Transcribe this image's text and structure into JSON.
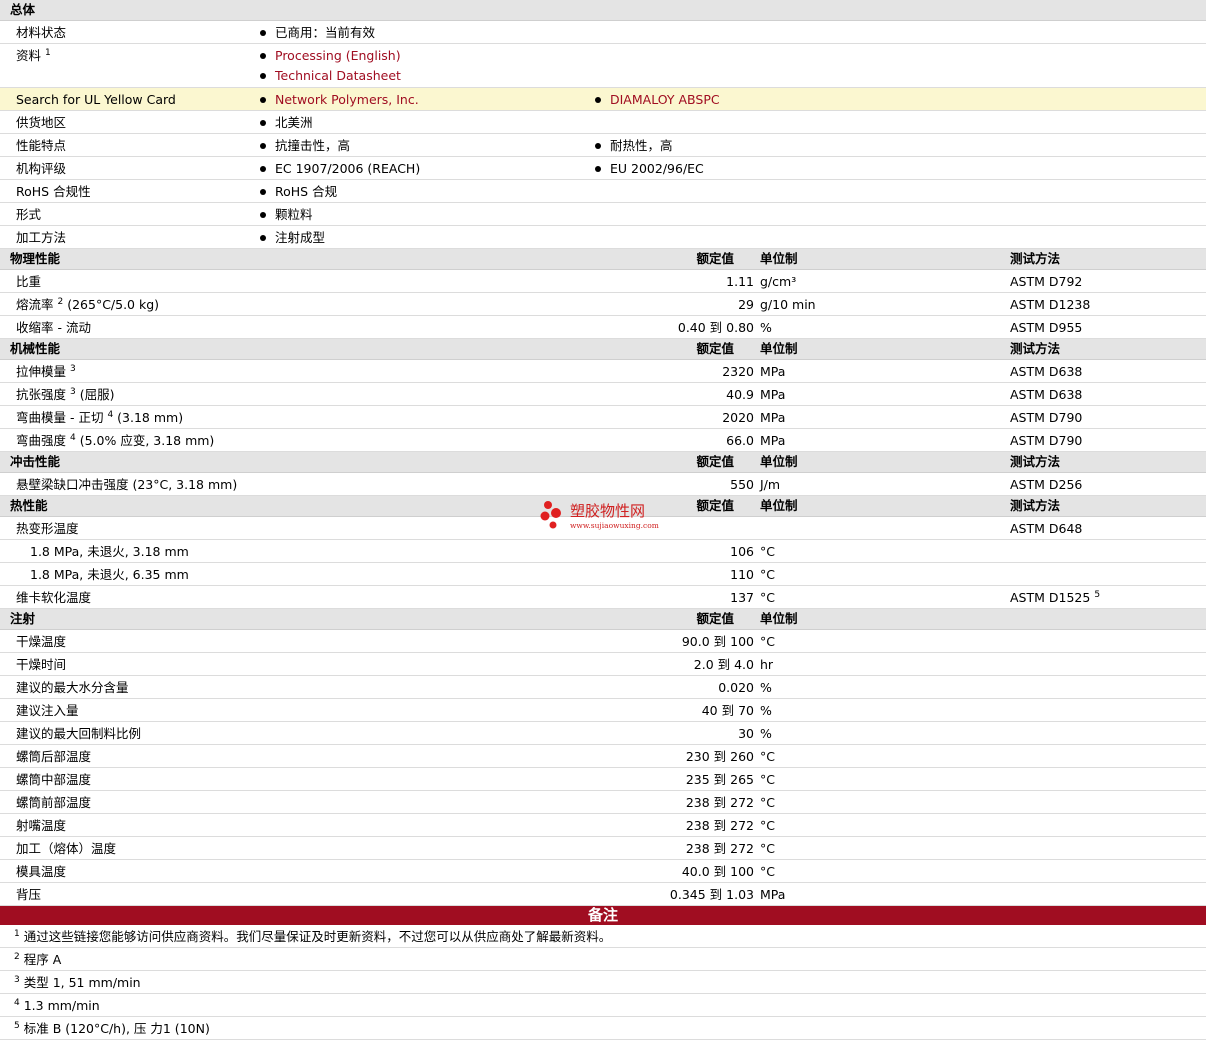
{
  "general": {
    "title": "总体",
    "rows": [
      {
        "label": "材料状态",
        "items": [
          {
            "text": "已商用：当前有效"
          }
        ]
      },
      {
        "label": "资料",
        "sup": "1",
        "items": [
          {
            "text": "Processing (English)",
            "link": true
          },
          {
            "text": "Technical Datasheet",
            "link": true
          }
        ]
      },
      {
        "label": "Search for UL Yellow Card",
        "items": [
          {
            "text": "Network Polymers, Inc.",
            "link": true
          },
          {
            "text": "DIAMALOY ABSPC",
            "link": true
          }
        ]
      },
      {
        "label": "供货地区",
        "items": [
          {
            "text": "北美洲"
          }
        ]
      },
      {
        "label": "性能特点",
        "items": [
          {
            "text": "抗撞击性，高"
          },
          {
            "text": "耐热性，高"
          }
        ]
      },
      {
        "label": "机构评级",
        "items": [
          {
            "text": "EC 1907/2006 (REACH)"
          },
          {
            "text": "EU 2002/96/EC"
          }
        ]
      },
      {
        "label": "RoHS 合规性",
        "items": [
          {
            "text": "RoHS 合规"
          }
        ]
      },
      {
        "label": "形式",
        "items": [
          {
            "text": "颗粒料"
          }
        ]
      },
      {
        "label": "加工方法",
        "items": [
          {
            "text": "注射成型"
          }
        ]
      }
    ]
  },
  "headers": {
    "value": "额定值",
    "unit": "单位制",
    "method": "测试方法"
  },
  "physical": {
    "title": "物理性能",
    "rows": [
      {
        "label": "比重",
        "value": "1.11",
        "unit": "g/cm³",
        "method": "ASTM D792"
      },
      {
        "label": "熔流率",
        "sup": "2",
        "suffix": " (265°C/5.0 kg)",
        "value": "29",
        "unit": "g/10 min",
        "method": "ASTM D1238"
      },
      {
        "label": "收缩率  - 流动",
        "value": "0.40 到  0.80",
        "unit": "%",
        "method": "ASTM D955"
      }
    ]
  },
  "mechanical": {
    "title": "机械性能",
    "rows": [
      {
        "label": "拉伸模量",
        "sup": "3",
        "suffix": "",
        "value": "2320",
        "unit": "MPa",
        "method": "ASTM D638"
      },
      {
        "label": "抗张强度",
        "sup": "3",
        "suffix": " (屈服)",
        "value": "40.9",
        "unit": "MPa",
        "method": "ASTM D638"
      },
      {
        "label": "弯曲模量  - 正切",
        "sup": "4",
        "suffix": " (3.18 mm)",
        "value": "2020",
        "unit": "MPa",
        "method": "ASTM D790"
      },
      {
        "label": "弯曲强度",
        "sup": "4",
        "suffix": " (5.0% 应变, 3.18 mm)",
        "value": "66.0",
        "unit": "MPa",
        "method": "ASTM D790"
      }
    ]
  },
  "impact": {
    "title": "冲击性能",
    "rows": [
      {
        "label": "悬壁梁缺口冲击强度  (23°C, 3.18 mm)",
        "value": "550",
        "unit": "J/m",
        "method": "ASTM D256"
      }
    ]
  },
  "thermal": {
    "title": "热性能",
    "rows": [
      {
        "label": "热变形温度",
        "value": "",
        "unit": "",
        "method": "ASTM D648"
      },
      {
        "label": "1.8 MPa, 未退火, 3.18 mm",
        "indent": true,
        "value": "106",
        "unit": "°C",
        "method": ""
      },
      {
        "label": "1.8 MPa, 未退火, 6.35 mm",
        "indent": true,
        "value": "110",
        "unit": "°C",
        "method": ""
      },
      {
        "label": "维卡软化温度",
        "value": "137",
        "unit": "°C",
        "method": "ASTM D1525",
        "msup": "5"
      }
    ]
  },
  "injection": {
    "title": "注射",
    "rows": [
      {
        "label": "干燥温度",
        "value": "90.0 到  100",
        "unit": "°C"
      },
      {
        "label": "干燥时间",
        "value": "2.0 到  4.0",
        "unit": "hr"
      },
      {
        "label": "建议的最大水分含量",
        "value": "0.020",
        "unit": "%"
      },
      {
        "label": "建议注入量",
        "value": "40 到  70",
        "unit": "%"
      },
      {
        "label": "建议的最大回制料比例",
        "value": "30",
        "unit": "%"
      },
      {
        "label": "螺筒后部温度",
        "value": "230 到  260",
        "unit": "°C"
      },
      {
        "label": "螺筒中部温度",
        "value": "235 到  265",
        "unit": "°C"
      },
      {
        "label": "螺筒前部温度",
        "value": "238 到  272",
        "unit": "°C"
      },
      {
        "label": "射嘴温度",
        "value": "238 到  272",
        "unit": "°C"
      },
      {
        "label": "加工（熔体）温度",
        "value": "238 到  272",
        "unit": "°C"
      },
      {
        "label": "模具温度",
        "value": "40.0 到  100",
        "unit": "°C"
      },
      {
        "label": "背压",
        "value": "0.345 到  1.03",
        "unit": "MPa"
      }
    ]
  },
  "notes": {
    "title": "备注",
    "items": [
      {
        "n": "1",
        "text": "通过这些链接您能够访问供应商资料。我们尽量保证及时更新资料，不过您可以从供应商处了解最新资料。"
      },
      {
        "n": "2",
        "text": "程序  A"
      },
      {
        "n": "3",
        "text": "类型  1, 51 mm/min"
      },
      {
        "n": "4",
        "text": "1.3 mm/min"
      },
      {
        "n": "5",
        "text": "标准  B (120°C/h), 压  力1 (10N)"
      }
    ]
  },
  "watermark": {
    "name": "塑胶物性网",
    "url": "www.sujiaowuxing.com"
  },
  "colors": {
    "link": "#a00d21",
    "highlight": "#fbf7d0",
    "notes_bar": "#a00d21"
  }
}
